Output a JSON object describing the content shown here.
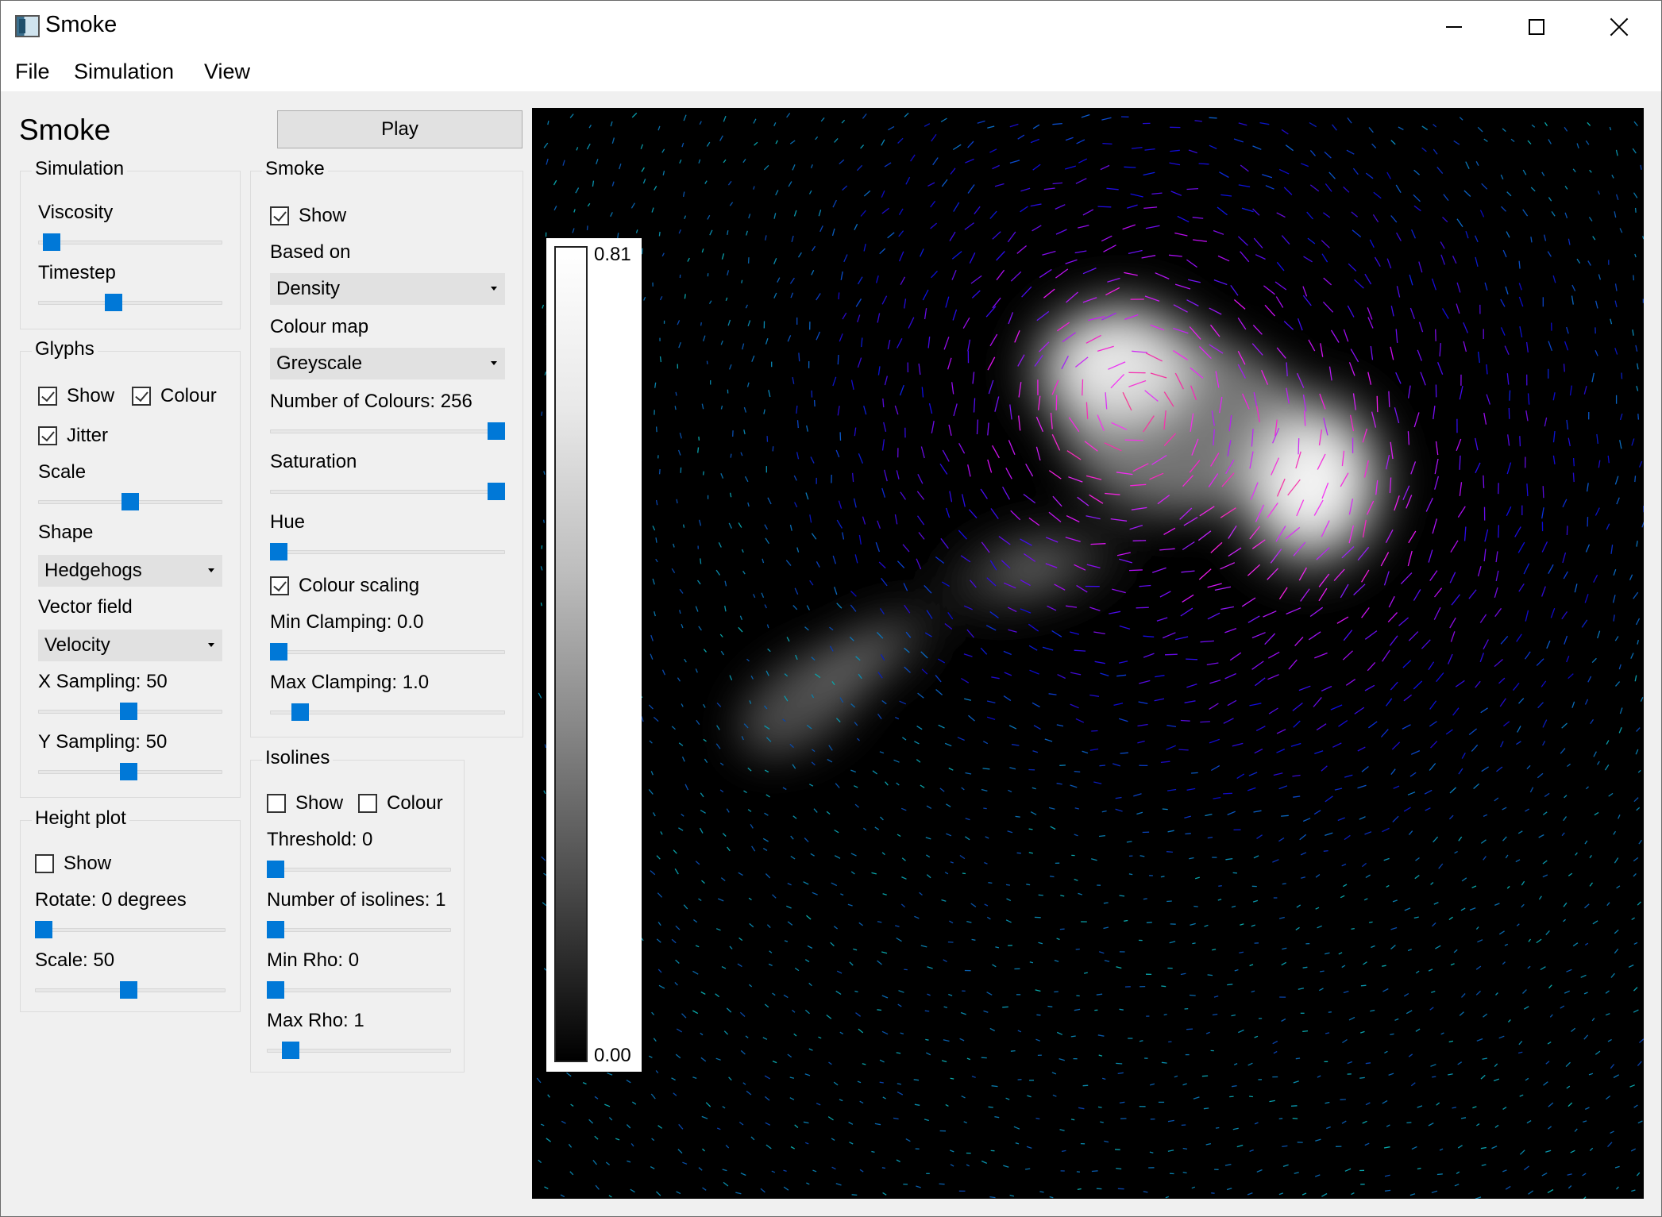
{
  "window": {
    "title": "Smoke"
  },
  "menu": [
    "File",
    "Simulation",
    "View"
  ],
  "panel_title": "Smoke",
  "play_label": "Play",
  "simulation": {
    "title": "Simulation",
    "viscosity_label": "Viscosity",
    "viscosity_value": 0.03,
    "timestep_label": "Timestep",
    "timestep_value": 0.4
  },
  "glyphs": {
    "title": "Glyphs",
    "show_label": "Show",
    "show_checked": true,
    "colour_label": "Colour",
    "colour_checked": true,
    "jitter_label": "Jitter",
    "jitter_checked": true,
    "scale_label": "Scale",
    "scale_value": 0.5,
    "shape_label": "Shape",
    "shape_value": "Hedgehogs",
    "vector_field_label": "Vector field",
    "vector_field_value": "Velocity",
    "x_sampling_label": "X Sampling: 50",
    "x_sampling_value": 0.49,
    "y_sampling_label": "Y Sampling: 50",
    "y_sampling_value": 0.49
  },
  "height_plot": {
    "title": "Height plot",
    "show_label": "Show",
    "show_checked": false,
    "rotate_label": "Rotate: 0 degrees",
    "rotate_value": 0.0,
    "scale_label": "Scale: 50",
    "scale_value": 0.49
  },
  "smoke": {
    "title": "Smoke",
    "show_label": "Show",
    "show_checked": true,
    "based_on_label": "Based on",
    "based_on_value": "Density",
    "colour_map_label": "Colour map",
    "colour_map_value": "Greyscale",
    "num_colours_label": "Number of Colours: 256",
    "num_colours_value": 1.0,
    "saturation_label": "Saturation",
    "saturation_value": 1.0,
    "hue_label": "Hue",
    "hue_value": 0.0,
    "colour_scaling_label": "Colour scaling",
    "colour_scaling_checked": true,
    "min_clamping_label": "Min Clamping: 0.0",
    "min_clamping_value": 0.0,
    "max_clamping_label": "Max Clamping: 1.0",
    "max_clamping_value": 0.1
  },
  "isolines": {
    "title": "Isolines",
    "show_label": "Show",
    "show_checked": false,
    "colour_label": "Colour",
    "colour_checked": false,
    "threshold_label": "Threshold: 0",
    "threshold_value": 0.0,
    "num_isolines_label": "Number of isolines: 1",
    "num_isolines_value": 0.0,
    "min_rho_label": "Min Rho: 0",
    "min_rho_value": 0.0,
    "max_rho_label": "Max Rho: 1",
    "max_rho_value": 0.09
  },
  "colorbar": {
    "max": "0.81",
    "min": "0.00"
  },
  "colors": {
    "accent": "#0078d7",
    "viewport_bg": "#000000"
  },
  "icons": {
    "minimize": "minimize-icon",
    "maximize": "maximize-icon",
    "close": "close-icon",
    "app": "app-icon"
  }
}
